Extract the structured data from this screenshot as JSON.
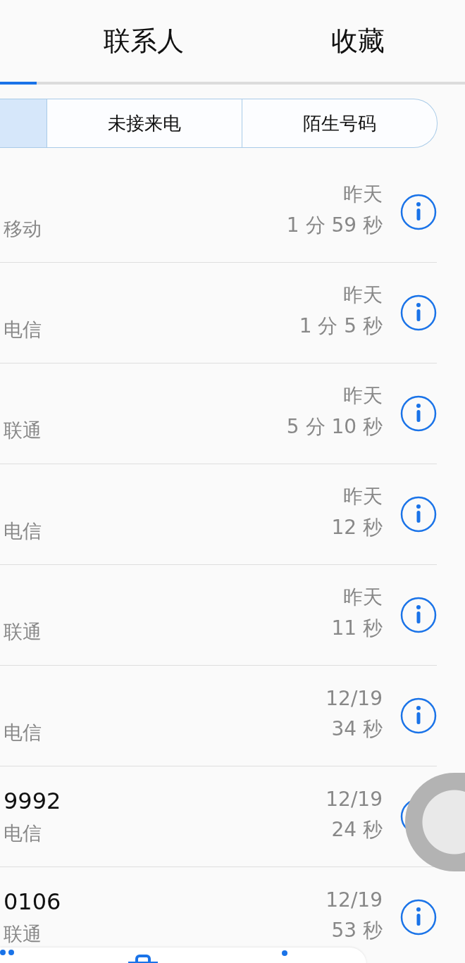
{
  "tabs": [
    {
      "label": "联系人",
      "selected": false
    },
    {
      "label": "收藏",
      "selected": false
    }
  ],
  "filters": [
    {
      "label": "未接来电",
      "selected": false
    },
    {
      "label": "陌生号码",
      "selected": false
    }
  ],
  "calls": [
    {
      "carrier": "移动",
      "date": "昨天",
      "duration": "1 分 59 秒"
    },
    {
      "carrier": "电信",
      "date": "昨天",
      "duration": "1 分 5 秒"
    },
    {
      "carrier": "联通",
      "date": "昨天",
      "duration": "5 分 10 秒"
    },
    {
      "carrier": "电信",
      "date": "昨天",
      "duration": "12 秒"
    },
    {
      "carrier": "联通",
      "date": "昨天",
      "duration": "11 秒"
    },
    {
      "carrier": "电信",
      "date": "12/19",
      "duration": "34 秒"
    },
    {
      "number": "9992",
      "carrier": "电信",
      "date": "12/19",
      "duration": "24 秒"
    },
    {
      "number": "0106",
      "carrier": "联通",
      "date": "12/19",
      "duration": "53 秒"
    }
  ]
}
